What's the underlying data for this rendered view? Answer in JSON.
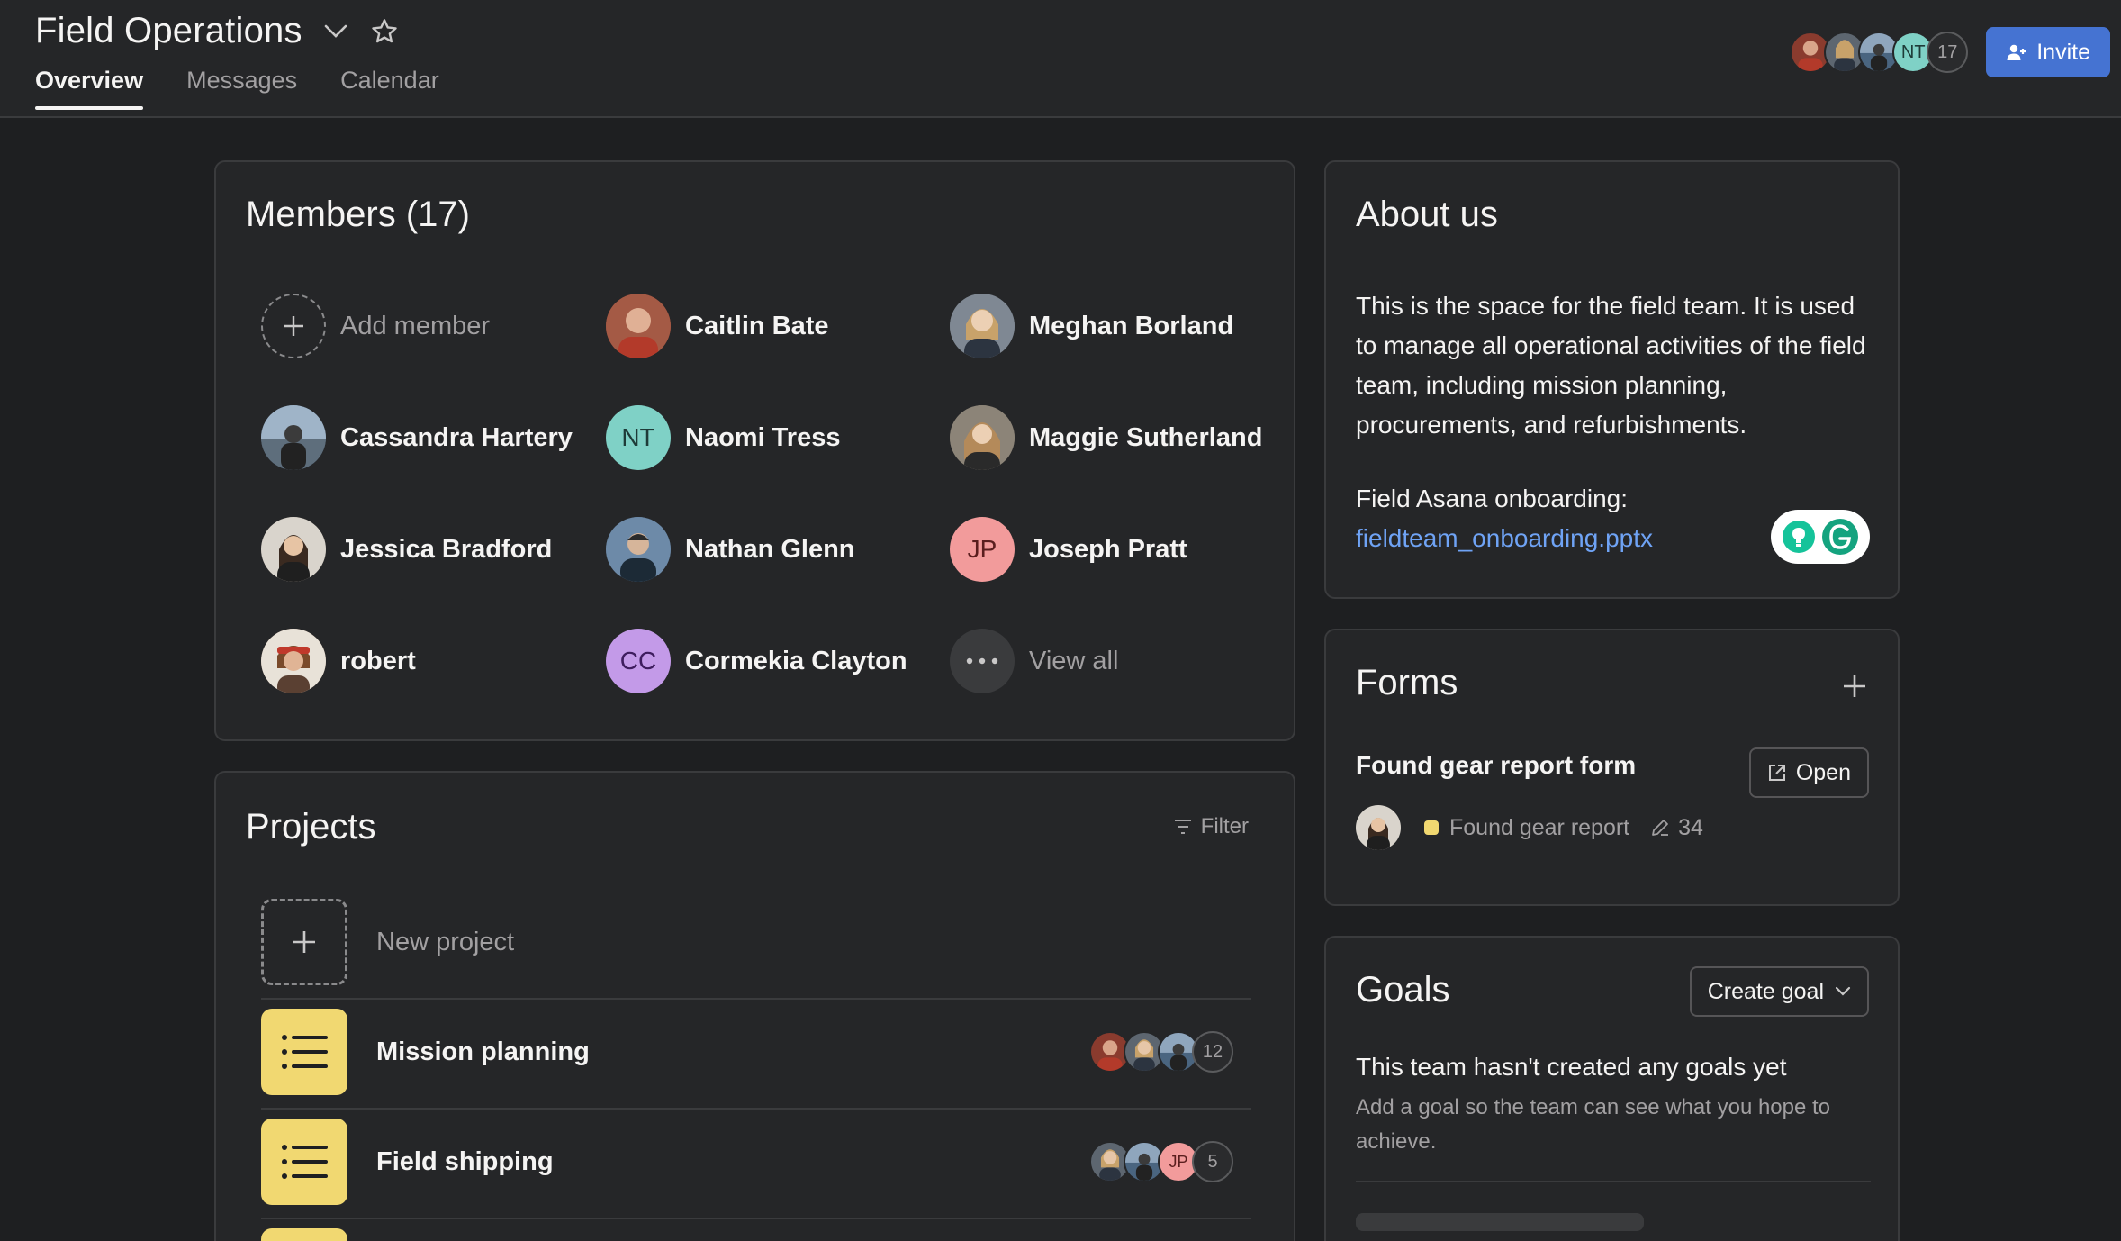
{
  "header": {
    "title": "Field Operations",
    "tabs": [
      {
        "label": "Overview",
        "active": true
      },
      {
        "label": "Messages",
        "active": false
      },
      {
        "label": "Calendar",
        "active": false
      }
    ],
    "facepile": {
      "initials": "NT",
      "count": "17"
    },
    "invite_label": "Invite"
  },
  "members": {
    "title": "Members (17)",
    "add_label": "Add member",
    "view_all_label": "View all",
    "list": [
      {
        "name": "Caitlin Bate",
        "initials": "",
        "color": "#8a3b2e"
      },
      {
        "name": "Meghan Borland",
        "initials": "",
        "color": "#5d6670"
      },
      {
        "name": "Cassandra Hartery",
        "initials": "",
        "color": "#4a6580"
      },
      {
        "name": "Naomi Tress",
        "initials": "NT",
        "color": "#7fd1c6"
      },
      {
        "name": "Maggie Sutherland",
        "initials": "",
        "color": "#6b6256"
      },
      {
        "name": "Jessica Bradford",
        "initials": "",
        "color": "#5a4a3e"
      },
      {
        "name": "Nathan Glenn",
        "initials": "",
        "color": "#3e5066"
      },
      {
        "name": "Joseph Pratt",
        "initials": "JP",
        "color": "#f29b9b"
      },
      {
        "name": "robert",
        "initials": "",
        "color": "#7a4e3a"
      },
      {
        "name": "Cormekia Clayton",
        "initials": "CC",
        "color": "#c39ae8"
      }
    ]
  },
  "projects": {
    "title": "Projects",
    "filter_label": "Filter",
    "new_label": "New project",
    "list": [
      {
        "name": "Mission planning",
        "count": "12"
      },
      {
        "name": "Field shipping",
        "count": "5",
        "initials": "JP"
      }
    ]
  },
  "about": {
    "title": "About us",
    "text": "This is the space for the field team. It is used to manage all operational activities of the field team, including mission planning, procurements, and refurbishments.",
    "onboarding_label": "Field Asana onboarding:",
    "onboarding_link": "fieldteam_onboarding.pptx"
  },
  "forms": {
    "title": "Forms",
    "form_name": "Found gear report form",
    "open_label": "Open",
    "meta_label": "Found gear report",
    "meta_count": "34"
  },
  "goals": {
    "title": "Goals",
    "create_label": "Create goal",
    "empty_title": "This team hasn't created any goals yet",
    "empty_sub": "Add a goal so the team can see what you hope to achieve."
  },
  "colors": {
    "background": "#1e1f21",
    "card": "#252628",
    "accent": "#4573d2",
    "link": "#6fa3f5",
    "project_icon": "#f1d871"
  }
}
